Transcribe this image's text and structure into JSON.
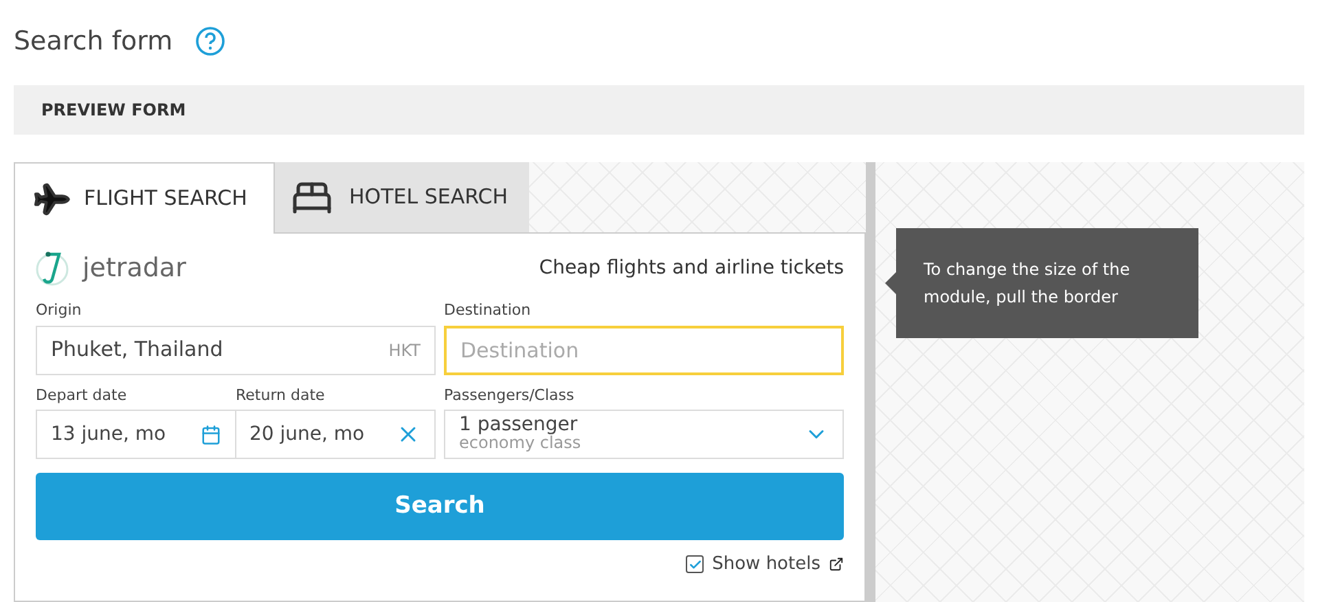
{
  "page_title": "Search form",
  "preview_bar": {
    "title": "PREVIEW FORM"
  },
  "tabs": [
    {
      "label": "FLIGHT SEARCH",
      "kind": "flight",
      "selected": true
    },
    {
      "label": "HOTEL SEARCH",
      "kind": "hotel",
      "selected": false
    }
  ],
  "brand": {
    "name": "jetradar",
    "tagline": "Cheap flights and airline tickets"
  },
  "origin": {
    "label": "Origin",
    "value": "Phuket, Thailand",
    "code": "HKT",
    "focused": false
  },
  "destination": {
    "label": "Destination",
    "placeholder": "Destination",
    "focused": true
  },
  "depart": {
    "label": "Depart date",
    "value": "13 june, mo"
  },
  "return": {
    "label": "Return date",
    "value": "20 june, mo"
  },
  "passengers": {
    "label": "Passengers/Class",
    "value": "1 passenger",
    "class": "economy class"
  },
  "search_button": "Search",
  "show_hotels": {
    "label": "Show hotels",
    "checked": true
  },
  "tooltip": "To change the size of the module, pull the border"
}
